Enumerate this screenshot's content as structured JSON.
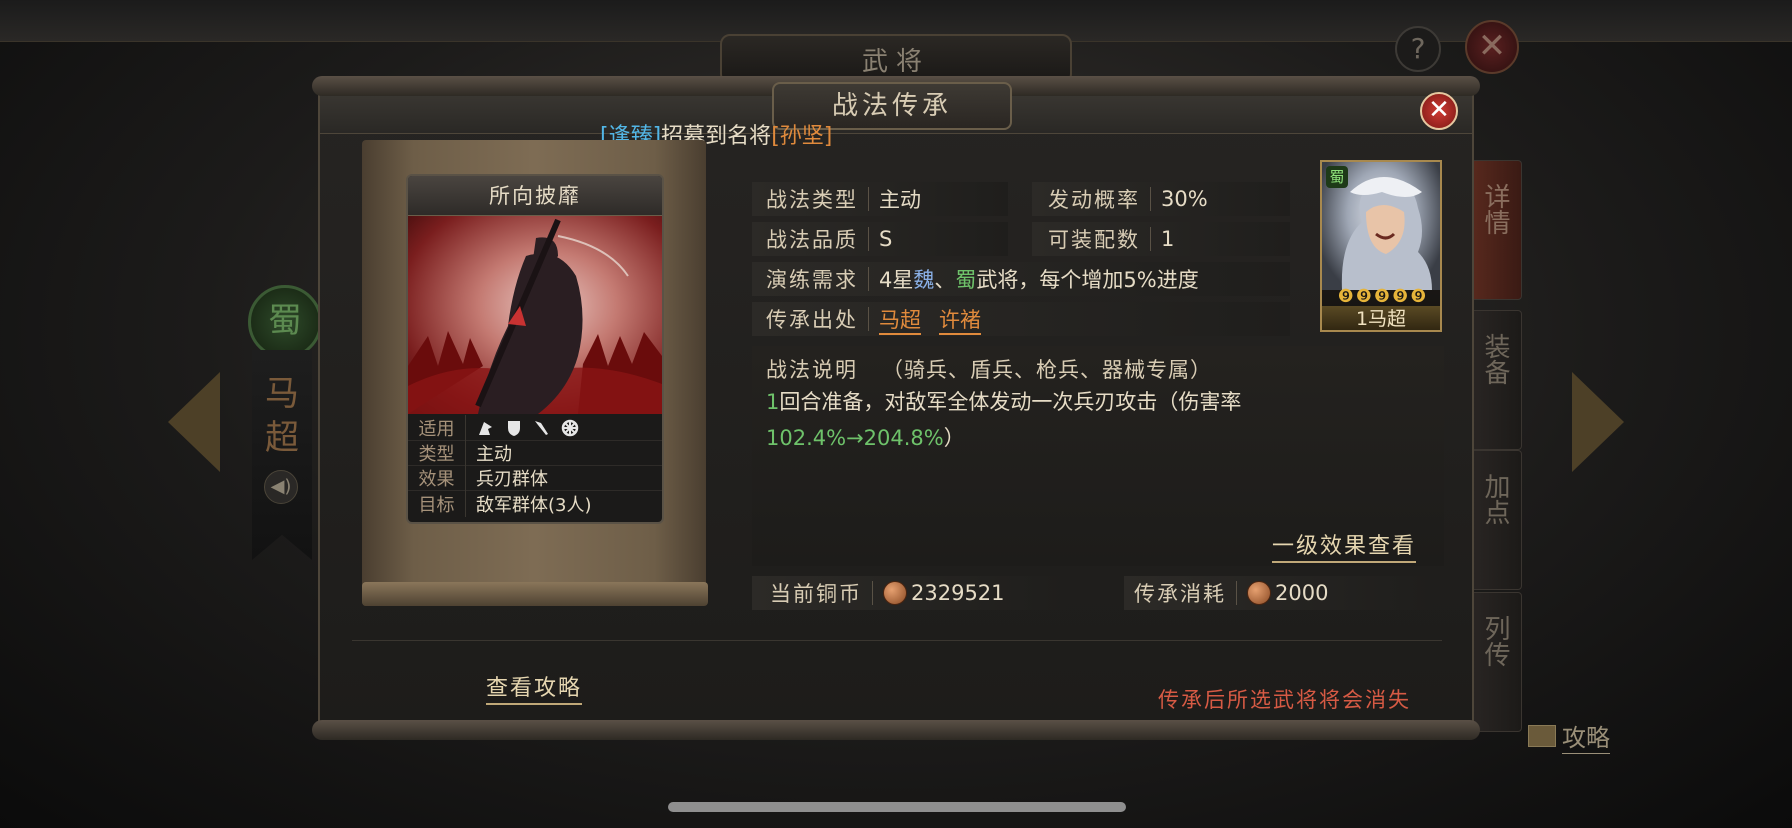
{
  "background": {
    "title": "武将",
    "help_glyph": "?",
    "close_glyph": "✕",
    "faction": "蜀",
    "general_name": "马超",
    "side_tabs": [
      "详情",
      "装备",
      "加点",
      "列传"
    ],
    "strategy_label": "攻略"
  },
  "dialog": {
    "title": "战法传承",
    "close_glyph": "✕",
    "notice": {
      "tag1": "[逢臻]",
      "middle": "招募到名将",
      "tag2": "[孙坚]"
    }
  },
  "card": {
    "name": "所向披靡",
    "stats": [
      {
        "key": "适用",
        "value": ""
      },
      {
        "key": "类型",
        "value": "主动"
      },
      {
        "key": "效果",
        "value": "兵刃群体"
      },
      {
        "key": "目标",
        "value": "敌军群体(3人)"
      }
    ],
    "troop_icons": [
      "cavalry-icon",
      "shield-icon",
      "spear-icon",
      "siege-icon"
    ]
  },
  "info": {
    "type_label": "战法类型",
    "type_value": "主动",
    "rate_label": "发动概率",
    "rate_value": "30%",
    "quality_label": "战法品质",
    "quality_value": "S",
    "equip_label": "可装配数",
    "equip_value": "1",
    "drill_label": "演练需求",
    "drill_prefix": "4星",
    "drill_wei": "魏",
    "drill_sep": "、",
    "drill_shu": "蜀",
    "drill_suffix": "武将，每个增加5%进度",
    "source_label": "传承出处",
    "source_1": "马超",
    "source_2": "许褚"
  },
  "portrait": {
    "faction": "蜀",
    "stars": "❾❾❾❾❾",
    "name": "1马超"
  },
  "description": {
    "title": "战法说明",
    "troops": "（骑兵、盾兵、枪兵、器械专属）",
    "line_prefix_num": "1",
    "line_text": "回合准备，对敌军全体发动一次兵刃攻击（伤害率",
    "dmg_range": "102.4%→204.8%",
    "line_end": "）",
    "level_link": "一级效果查看"
  },
  "costs": {
    "copper_label": "当前铜币",
    "copper_value": "2329521",
    "cost_label": "传承消耗",
    "cost_value": "2000"
  },
  "footer": {
    "guide_link": "查看攻略",
    "warning": "传承后所选武将将会消失"
  },
  "colors": {
    "accent_orange": "#e08a3c",
    "accent_blue": "#52b6e6",
    "accent_green": "#6ec26a",
    "warning_red": "#d65a44"
  }
}
